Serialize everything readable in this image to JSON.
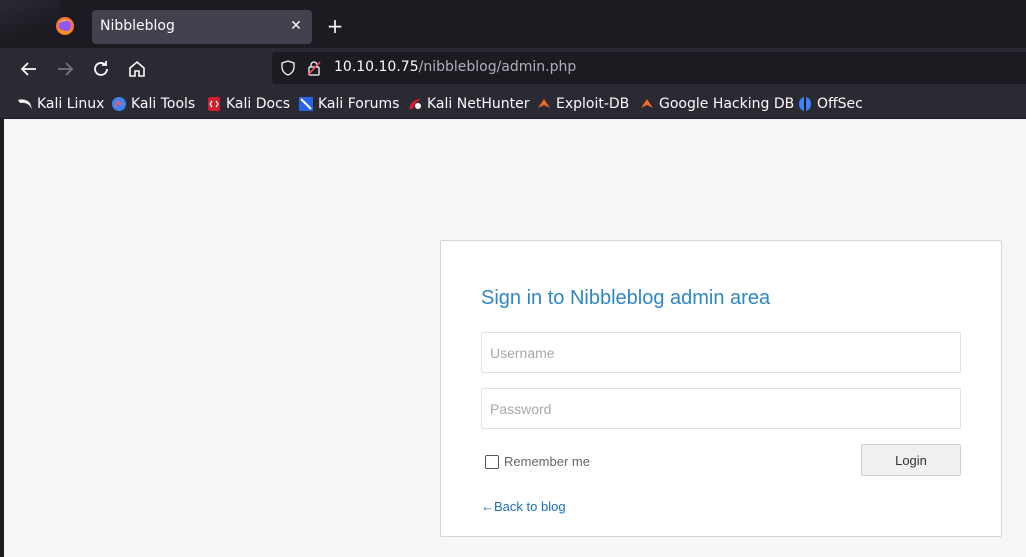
{
  "browser": {
    "tab": {
      "title": "Nibbleblog",
      "close_glyph": "✕"
    },
    "new_tab_glyph": "+",
    "url": {
      "host": "10.10.10.75",
      "path": "/nibbleblog/admin.php"
    },
    "nav_icons": [
      "back-arrow-icon",
      "forward-arrow-icon",
      "reload-icon",
      "home-icon"
    ],
    "bookmarks": [
      {
        "label": "Kali Linux",
        "icon": "kali-dragon-icon",
        "color": "#ffffff"
      },
      {
        "label": "Kali Tools",
        "icon": "kali-tools-icon",
        "color": "#3b82f6"
      },
      {
        "label": "Kali Docs",
        "icon": "kali-docs-icon",
        "color": "#d11f2f"
      },
      {
        "label": "Kali Forums",
        "icon": "kali-forums-icon",
        "color": "#2563eb"
      },
      {
        "label": "Kali NetHunter",
        "icon": "nethunter-icon",
        "color": "#d11f2f"
      },
      {
        "label": "Exploit-DB",
        "icon": "exploit-db-icon",
        "color": "#e96b24"
      },
      {
        "label": "Google Hacking DB",
        "icon": "ghdb-icon",
        "color": "#e96b24"
      },
      {
        "label": "OffSec",
        "icon": "offsec-icon",
        "color": "#3b82f6"
      }
    ]
  },
  "page": {
    "title": "Sign in to Nibbleblog admin area",
    "username_placeholder": "Username",
    "password_placeholder": "Password",
    "remember_label": "Remember me",
    "remember_checked": false,
    "login_label": "Login",
    "back_label": "←Back to blog",
    "accent_color": "#2e87c6"
  }
}
